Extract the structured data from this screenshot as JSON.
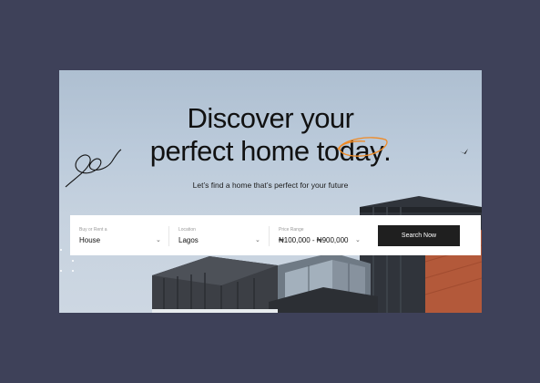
{
  "hero": {
    "headline_line1": "Discover your",
    "headline_line2_prefix": "perfect home to",
    "headline_highlight": "day",
    "headline_punct": ".",
    "subtitle": "Let’s find a home that’s perfect for your future"
  },
  "search": {
    "field1": {
      "label": "Buy or Rent a",
      "value": "House"
    },
    "field2": {
      "label": "Location",
      "value": "Lagos"
    },
    "field3": {
      "label": "Price Range",
      "value": "₦100,000 - ₦900,000"
    },
    "button_label": "Search Now"
  },
  "colors": {
    "page_background": "#3e4159",
    "highlight_scribble": "#f08a24",
    "button": "#1f1f1f"
  },
  "icons": [
    "scribble-decoration",
    "bird-icon",
    "chevron-down-icon",
    "dots-decoration"
  ]
}
